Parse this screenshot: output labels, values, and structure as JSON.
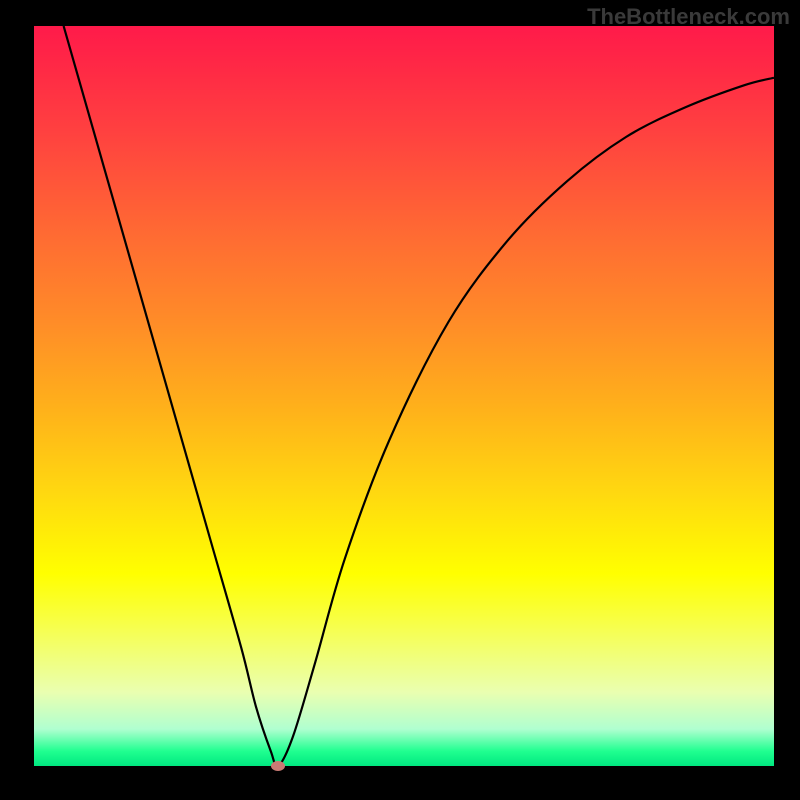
{
  "watermark": "TheBottleneck.com",
  "chart_data": {
    "type": "line",
    "title": "",
    "xlabel": "",
    "ylabel": "",
    "xlim": [
      0,
      100
    ],
    "ylim": [
      0,
      100
    ],
    "background_gradient": {
      "top": "#ff1a4a",
      "mid": "#ffff00",
      "bottom": "#00e880"
    },
    "series": [
      {
        "name": "curve",
        "x": [
          4,
          8,
          12,
          16,
          20,
          24,
          28,
          30,
          32,
          33,
          35,
          38,
          42,
          48,
          56,
          64,
          72,
          80,
          88,
          96,
          100
        ],
        "values": [
          100,
          86,
          72,
          58,
          44,
          30,
          16,
          8,
          2,
          0,
          4,
          14,
          28,
          44,
          60,
          71,
          79,
          85,
          89,
          92,
          93
        ]
      }
    ],
    "marker": {
      "x": 33,
      "y": 0,
      "color": "#c97a74"
    }
  }
}
